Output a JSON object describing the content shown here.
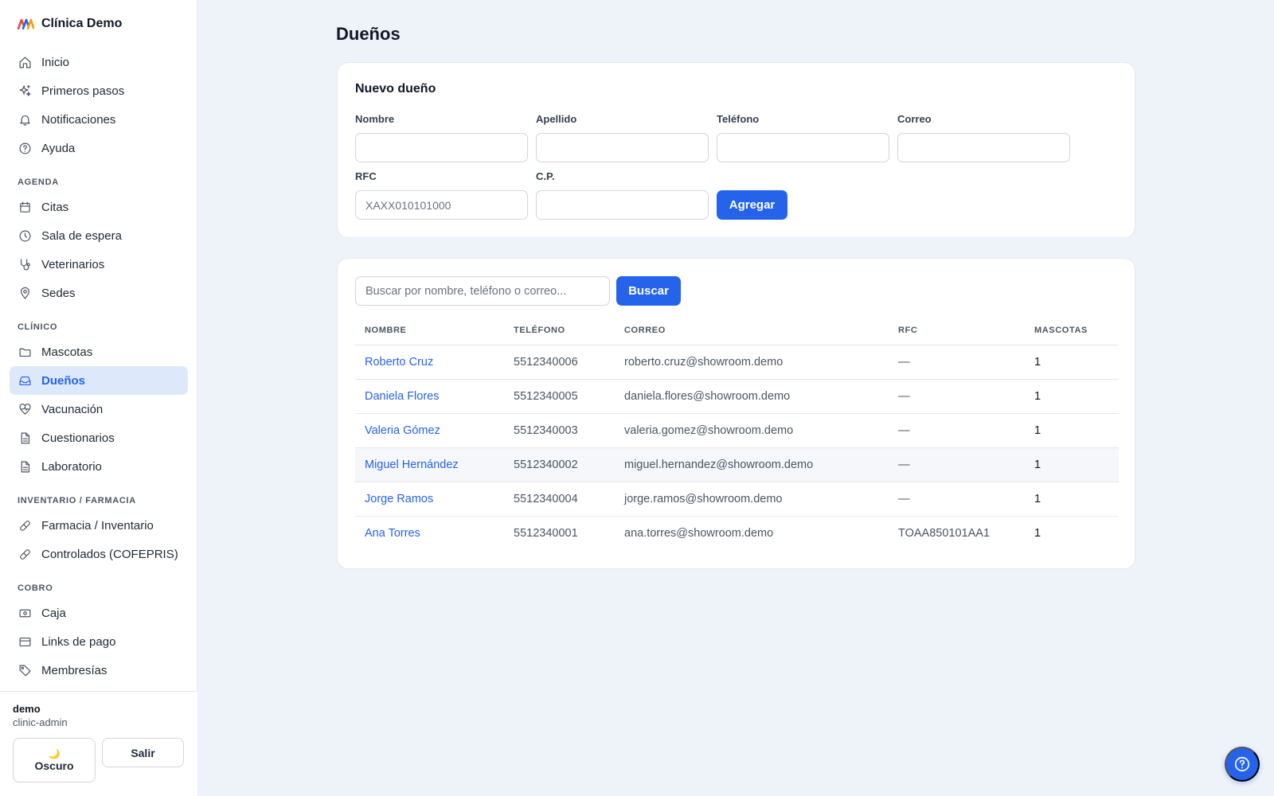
{
  "app": {
    "title": "Clínica Demo",
    "accent_color": "#2563eb"
  },
  "sidebar": {
    "top_items": [
      {
        "label": "Inicio",
        "icon": "home-icon"
      },
      {
        "label": "Primeros pasos",
        "icon": "sparkles-icon"
      },
      {
        "label": "Notificaciones",
        "icon": "bell-icon"
      },
      {
        "label": "Ayuda",
        "icon": "help-circle-icon"
      }
    ],
    "sections": [
      {
        "title": "AGENDA",
        "items": [
          {
            "label": "Citas",
            "icon": "calendar-icon"
          },
          {
            "label": "Sala de espera",
            "icon": "clock-icon"
          },
          {
            "label": "Veterinarios",
            "icon": "stethoscope-icon"
          },
          {
            "label": "Sedes",
            "icon": "map-pin-icon"
          }
        ]
      },
      {
        "title": "CLÍNICO",
        "items": [
          {
            "label": "Mascotas",
            "icon": "folder-icon"
          },
          {
            "label": "Dueños",
            "icon": "inbox-icon",
            "active": true
          },
          {
            "label": "Vacunación",
            "icon": "heart-pulse-icon"
          },
          {
            "label": "Cuestionarios",
            "icon": "document-icon"
          },
          {
            "label": "Laboratorio",
            "icon": "document-icon"
          }
        ]
      },
      {
        "title": "INVENTARIO / FARMACIA",
        "items": [
          {
            "label": "Farmacia / Inventario",
            "icon": "pill-icon"
          },
          {
            "label": "Controlados (COFEPRIS)",
            "icon": "pill-icon"
          }
        ]
      },
      {
        "title": "COBRO",
        "items": [
          {
            "label": "Caja",
            "icon": "cash-icon"
          },
          {
            "label": "Links de pago",
            "icon": "credit-card-icon"
          },
          {
            "label": "Membresías",
            "icon": "tag-icon"
          }
        ]
      }
    ],
    "footer": {
      "user_name": "demo",
      "user_role": "clinic-admin",
      "theme_icon": "🌙",
      "theme_label": "Oscuro",
      "logout_label": "Salir"
    }
  },
  "page": {
    "title": "Dueños"
  },
  "form": {
    "title": "Nuevo dueño",
    "fields": {
      "nombre": {
        "label": "Nombre",
        "value": "",
        "placeholder": ""
      },
      "apellido": {
        "label": "Apellido",
        "value": "",
        "placeholder": ""
      },
      "telefono": {
        "label": "Teléfono",
        "value": "",
        "placeholder": ""
      },
      "correo": {
        "label": "Correo",
        "value": "",
        "placeholder": ""
      },
      "rfc": {
        "label": "RFC",
        "value": "",
        "placeholder": "XAXX010101000"
      },
      "cp": {
        "label": "C.P.",
        "value": "",
        "placeholder": ""
      }
    },
    "submit_label": "Agregar"
  },
  "list": {
    "search_placeholder": "Buscar por nombre, teléfono o correo...",
    "search_value": "",
    "search_button": "Buscar",
    "columns": [
      "NOMBRE",
      "TELÉFONO",
      "CORREO",
      "RFC",
      "MASCOTAS"
    ],
    "rows": [
      {
        "nombre": "Roberto Cruz",
        "telefono": "5512340006",
        "correo": "roberto.cruz@showroom.demo",
        "rfc": "—",
        "mascotas": "1"
      },
      {
        "nombre": "Daniela Flores",
        "telefono": "5512340005",
        "correo": "daniela.flores@showroom.demo",
        "rfc": "—",
        "mascotas": "1"
      },
      {
        "nombre": "Valeria Gómez",
        "telefono": "5512340003",
        "correo": "valeria.gomez@showroom.demo",
        "rfc": "—",
        "mascotas": "1"
      },
      {
        "nombre": "Miguel Hernández",
        "telefono": "5512340002",
        "correo": "miguel.hernandez@showroom.demo",
        "rfc": "—",
        "mascotas": "1",
        "hovered": true
      },
      {
        "nombre": "Jorge Ramos",
        "telefono": "5512340004",
        "correo": "jorge.ramos@showroom.demo",
        "rfc": "—",
        "mascotas": "1"
      },
      {
        "nombre": "Ana Torres",
        "telefono": "5512340001",
        "correo": "ana.torres@showroom.demo",
        "rfc": "TOAA850101AA1",
        "mascotas": "1"
      }
    ]
  },
  "help_button": {
    "icon": "help-circle-icon"
  }
}
